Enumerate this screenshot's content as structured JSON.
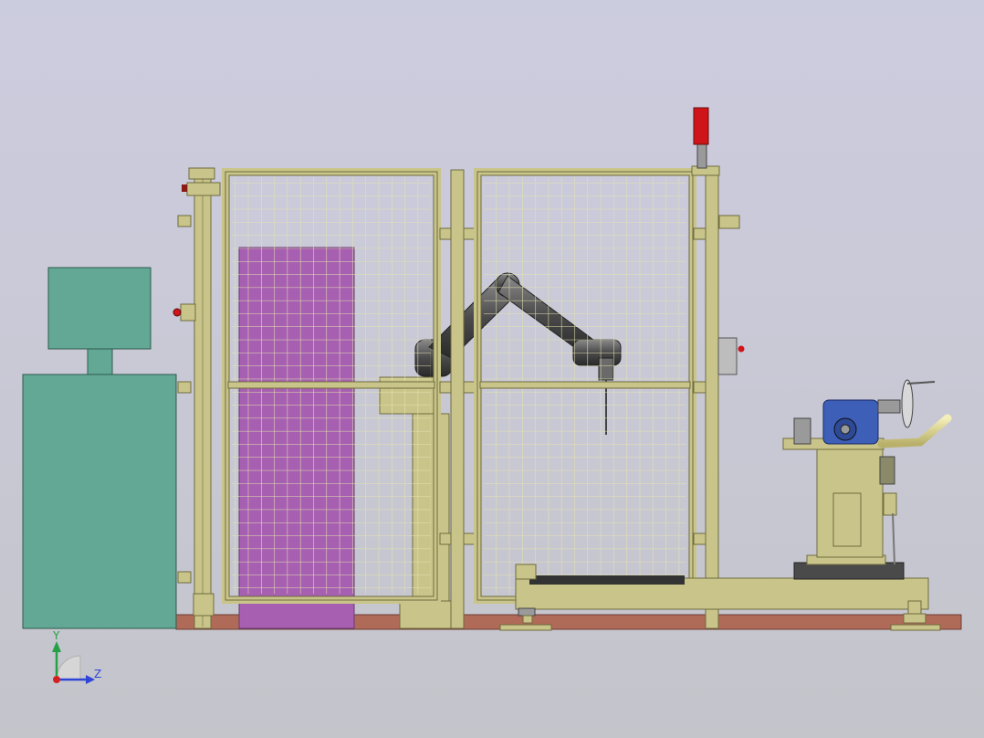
{
  "colors": {
    "background_top": "#ccccdf",
    "background_bottom": "#c4c4cb",
    "floor": "#b06a58",
    "floor_edge": "#6e3e33",
    "frame": "#c9c58a",
    "frame_dark": "#8e8a55",
    "mesh": "#e4e2b0",
    "cabinet": "#63a894",
    "cabinet_edge": "#2f5a4e",
    "panel_purple": "#a75fb1",
    "robot": "#5c5c5c",
    "robot_dark": "#2f2f2f",
    "gearbox_blue": "#3d5fb8",
    "beacon_red": "#d0151a",
    "y_axis": "#25a046",
    "z_axis": "#2f45d8",
    "origin": "#d62020"
  },
  "icons": {
    "emergency_stop": "emergency-stop-icon",
    "handwheel": "handwheel-icon"
  },
  "axis_triad": {
    "y_label": "Y",
    "z_label": "Z"
  }
}
